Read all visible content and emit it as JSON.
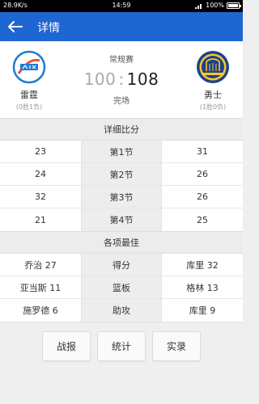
{
  "status_bar": {
    "network": "28.9K/s",
    "time": "14:59",
    "battery": "100%"
  },
  "app_bar": {
    "title": "详情"
  },
  "match": {
    "game_type": "常规赛",
    "status": "完场",
    "home": {
      "name": "雷霆",
      "record": "(0胜1负)",
      "score": "100",
      "logo_color": "#1e7bd6"
    },
    "away": {
      "name": "勇士",
      "record": "(1胜0负)",
      "score": "108",
      "logo_color": "#1d428a"
    },
    "score_separator": ":"
  },
  "quarters": {
    "title": "详细比分",
    "rows": [
      {
        "left": "23",
        "label": "第1节",
        "right": "31"
      },
      {
        "left": "24",
        "label": "第2节",
        "right": "26"
      },
      {
        "left": "32",
        "label": "第3节",
        "right": "26"
      },
      {
        "left": "21",
        "label": "第4节",
        "right": "25"
      }
    ]
  },
  "leaders": {
    "title": "各项最佳",
    "rows": [
      {
        "left": "乔治 27",
        "label": "得分",
        "right": "库里 32"
      },
      {
        "left": "亚当斯 11",
        "label": "篮板",
        "right": "格林 13"
      },
      {
        "left": "施罗德 6",
        "label": "助攻",
        "right": "库里 9"
      }
    ]
  },
  "tabs": [
    {
      "label": "战报"
    },
    {
      "label": "统计"
    },
    {
      "label": "实录"
    }
  ],
  "icons": {
    "back": "arrow-left-icon",
    "signal": "signal-icon",
    "battery": "battery-icon"
  }
}
